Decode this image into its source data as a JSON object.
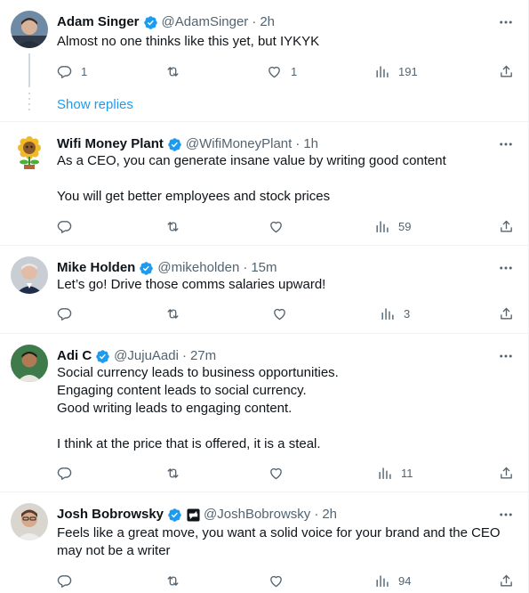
{
  "tweets": [
    {
      "name": "Adam Singer",
      "handle": "@AdamSinger",
      "time": "2h",
      "text": "Almost no one thinks like this yet, but IYKYK",
      "replies": "1",
      "retweets": "",
      "likes": "1",
      "views": "191",
      "verified": true
    },
    {
      "name": "Wifi Money Plant",
      "handle": "@WifiMoneyPlant",
      "time": "1h",
      "text": "As a CEO, you can generate insane value by writing good content\n\nYou will get better employees and stock prices",
      "replies": "",
      "retweets": "",
      "likes": "",
      "views": "59",
      "verified": true
    },
    {
      "name": "Mike Holden",
      "handle": "@mikeholden",
      "time": "15m",
      "text": "Let’s go! Drive those comms salaries upward!",
      "replies": "",
      "retweets": "",
      "likes": "",
      "views": "3",
      "verified": true
    },
    {
      "name": "Adi C",
      "handle": "@JujuAadi",
      "time": "27m",
      "text": "Social currency leads to business opportunities.\nEngaging content leads to social currency.\nGood writing leads to engaging content.\n\nI think at the price that is offered, it is a steal.",
      "replies": "",
      "retweets": "",
      "likes": "",
      "views": "11",
      "verified": true
    },
    {
      "name": "Josh Bobrowsky",
      "handle": "@JoshBobrowsky",
      "time": "2h",
      "text": "Feels like a great move, you want a solid voice for your brand and the CEO may not be a writer",
      "replies": "",
      "retweets": "",
      "likes": "",
      "views": "94",
      "verified": true,
      "affiliate": true
    }
  ],
  "show_replies_label": "Show replies",
  "separator": "·",
  "colors": {
    "accent": "#1d9bf0",
    "text": "#0f1419",
    "secondary": "#536471",
    "border": "#eff3f4"
  },
  "icons": [
    "verified-badge-icon",
    "affiliate-badge-icon",
    "more-icon",
    "reply-icon",
    "retweet-icon",
    "like-icon",
    "views-icon",
    "share-icon"
  ]
}
